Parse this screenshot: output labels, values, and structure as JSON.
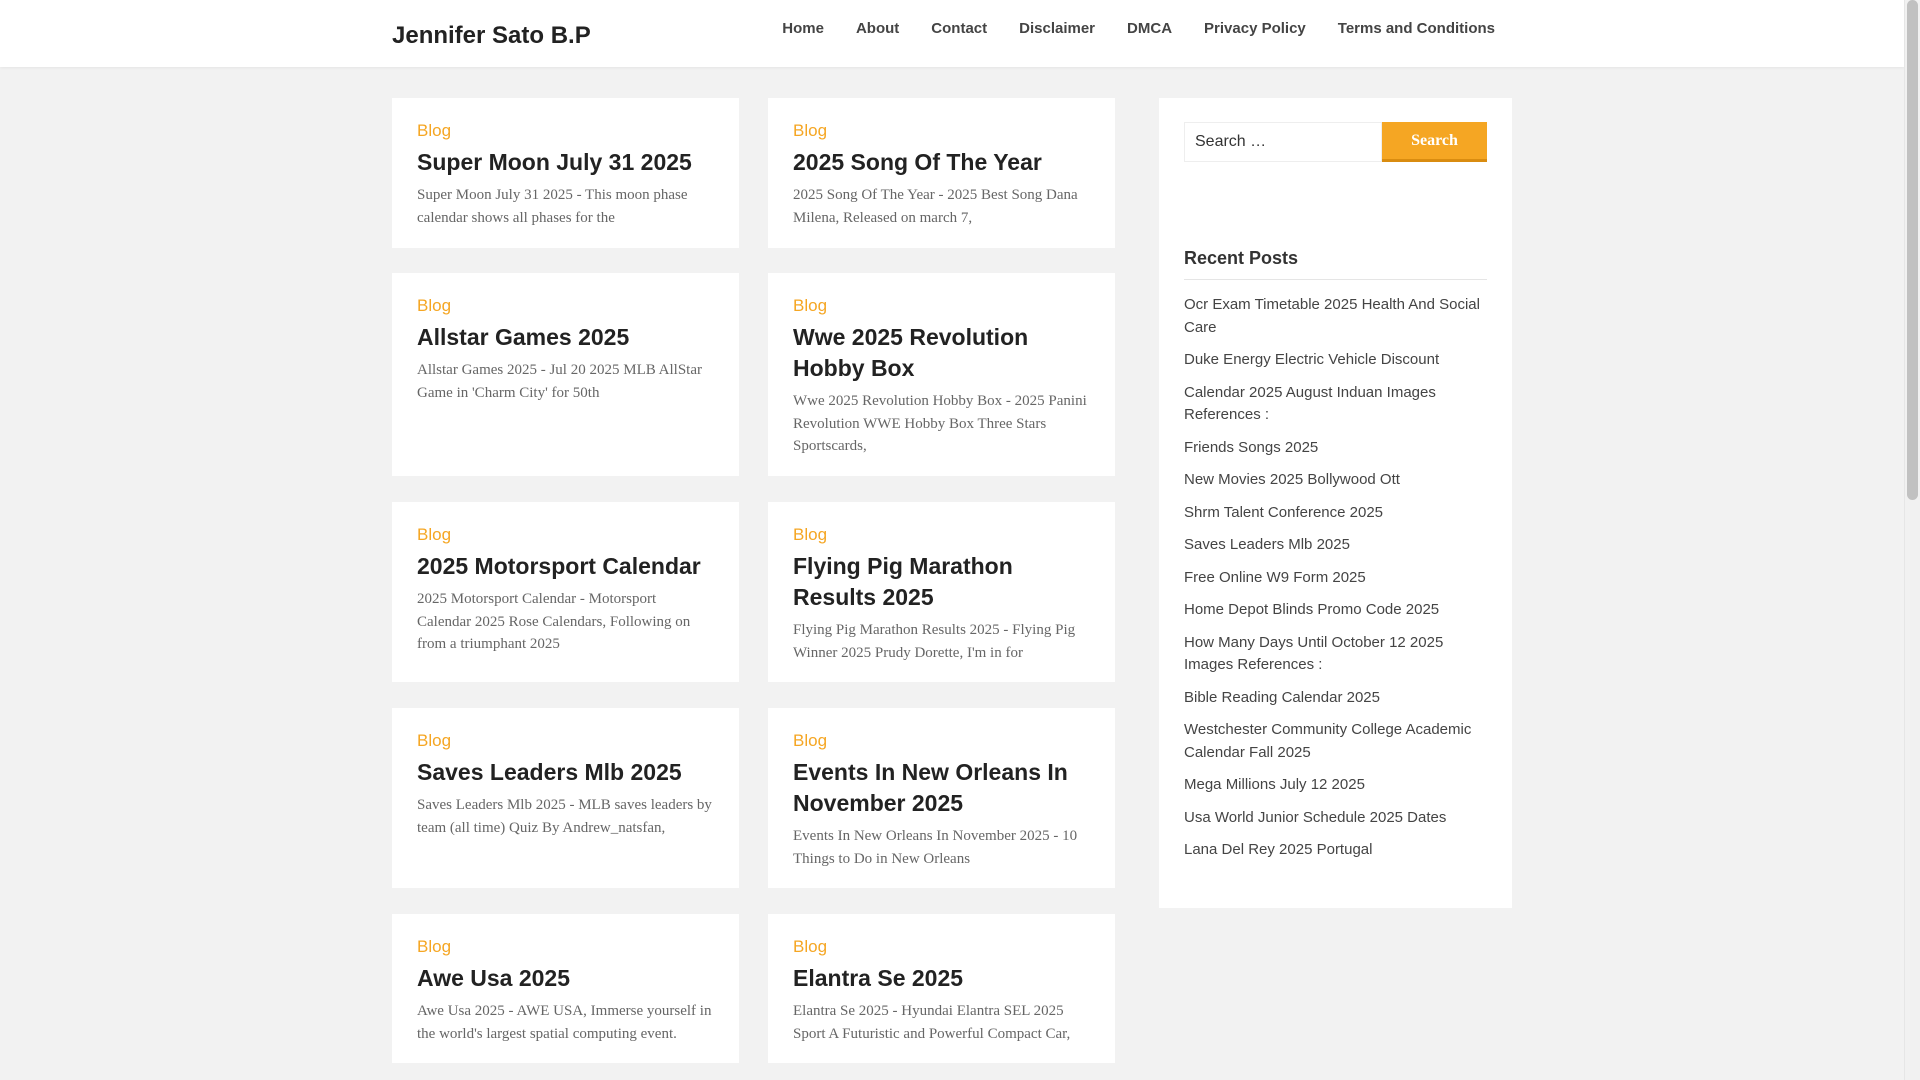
{
  "site": {
    "title": "Jennifer Sato B.P"
  },
  "nav": [
    {
      "label": "Home"
    },
    {
      "label": "About"
    },
    {
      "label": "Contact"
    },
    {
      "label": "Disclaimer"
    },
    {
      "label": "DMCA"
    },
    {
      "label": "Privacy Policy"
    },
    {
      "label": "Terms and Conditions"
    }
  ],
  "posts": [
    {
      "category": "Blog",
      "title": "Super Moon July 31 2025",
      "excerpt": "Super Moon July 31 2025 - This moon phase calendar shows all phases for the"
    },
    {
      "category": "Blog",
      "title": "2025 Song Of The Year",
      "excerpt": "2025 Song Of The Year - 2025 Best Song Dana Milena, Released on march 7,"
    },
    {
      "category": "Blog",
      "title": "Allstar Games 2025",
      "excerpt": "Allstar Games 2025 - Jul 20 2025 MLB AllStar Game in 'Charm City' for 50th"
    },
    {
      "category": "Blog",
      "title": "Wwe 2025 Revolution Hobby Box",
      "excerpt": "Wwe 2025 Revolution Hobby Box - 2025 Panini Revolution WWE Hobby Box Three Stars Sportscards,"
    },
    {
      "category": "Blog",
      "title": "2025 Motorsport Calendar",
      "excerpt": "2025 Motorsport Calendar - Motorsport Calendar 2025 Rose Calendars, Following on from a triumphant 2025"
    },
    {
      "category": "Blog",
      "title": "Flying Pig Marathon Results 2025",
      "excerpt": "Flying Pig Marathon Results 2025 - Flying Pig Winner 2025 Prudy Dorette, I'm in for"
    },
    {
      "category": "Blog",
      "title": "Saves Leaders Mlb 2025",
      "excerpt": "Saves Leaders Mlb 2025 - MLB saves leaders by team (all time) Quiz By Andrew_natsfan,"
    },
    {
      "category": "Blog",
      "title": "Events In New Orleans In November 2025",
      "excerpt": "Events In New Orleans In November 2025 - 10 Things to Do in New Orleans"
    },
    {
      "category": "Blog",
      "title": "Awe Usa 2025",
      "excerpt": "Awe Usa 2025 - AWE USA, Immerse yourself in the world's largest spatial computing event."
    },
    {
      "category": "Blog",
      "title": "Elantra Se 2025",
      "excerpt": "Elantra Se 2025 - Hyundai Elantra SEL 2025 Sport A Futuristic and Powerful Compact Car,"
    }
  ],
  "sidebar": {
    "search": {
      "placeholder": "Search …",
      "button_label": "Search"
    },
    "recent_title": "Recent Posts",
    "recent_posts": [
      "Ocr Exam Timetable 2025 Health And Social Care",
      "Duke Energy Electric Vehicle Discount",
      "Calendar 2025 August Induan Images References :",
      "Friends Songs 2025",
      "New Movies 2025 Bollywood Ott",
      "Shrm Talent Conference 2025",
      "Saves Leaders Mlb 2025",
      "Free Online W9 Form 2025",
      "Home Depot Blinds Promo Code 2025",
      "How Many Days Until October 12 2025 Images References :",
      "Bible Reading Calendar 2025",
      "Westchester Community College Academic Calendar Fall 2025",
      "Mega Millions July 12 2025",
      "Usa World Junior Schedule 2025 Dates",
      "Lana Del Rey 2025 Portugal"
    ]
  },
  "colors": {
    "accent": "#f5a623",
    "background": "#f2f2f2",
    "card": "#ffffff"
  }
}
